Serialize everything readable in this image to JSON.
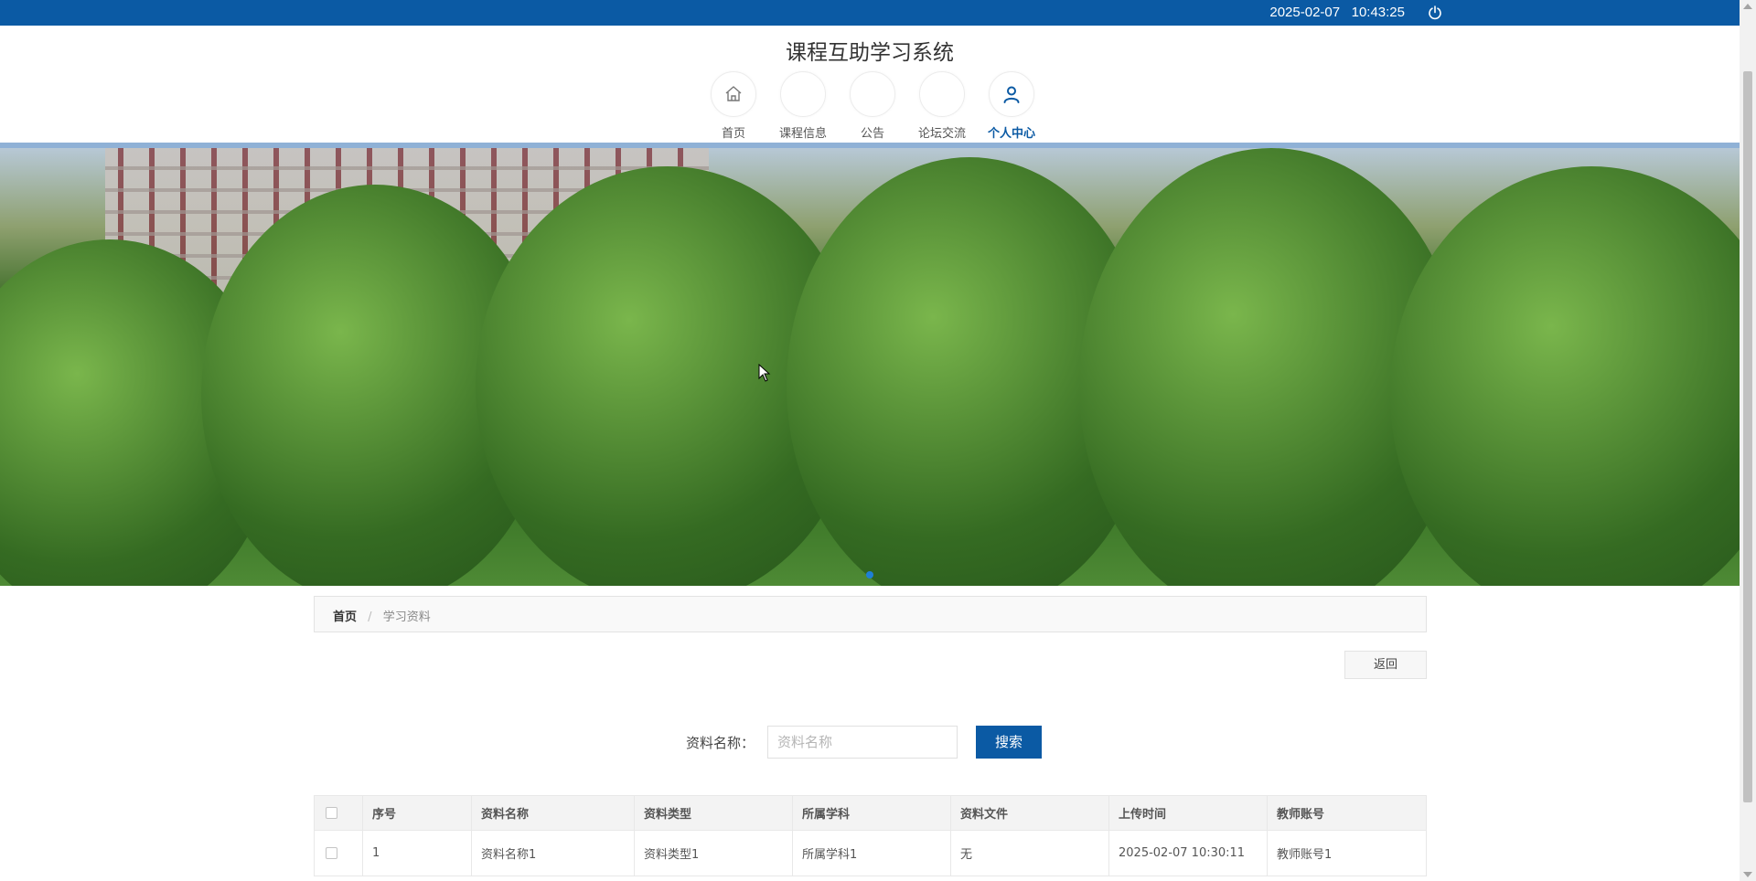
{
  "topbar": {
    "datetime": "2025-02-07   10:43:25",
    "power_icon": "power-icon",
    "color": "#0b5aa4"
  },
  "site": {
    "title": "课程互助学习系统"
  },
  "nav": {
    "items": [
      {
        "label": "首页",
        "icon": "home-icon",
        "active": false
      },
      {
        "label": "课程信息",
        "icon": "",
        "active": false
      },
      {
        "label": "公告",
        "icon": "",
        "active": false
      },
      {
        "label": "论坛交流",
        "icon": "",
        "active": false
      },
      {
        "label": "个人中心",
        "icon": "user-icon",
        "active": true
      }
    ]
  },
  "banner": {
    "slide_indicator": "carousel-dot"
  },
  "breadcrumb": {
    "home": "首页",
    "separator": "/",
    "current": "学习资料"
  },
  "actions": {
    "back_label": "返回"
  },
  "search": {
    "label": "资料名称：",
    "placeholder": "资料名称",
    "value": "",
    "button_label": "搜索"
  },
  "table": {
    "headers": [
      "序号",
      "资料名称",
      "资料类型",
      "所属学科",
      "资料文件",
      "上传时间",
      "教师账号"
    ],
    "rows": [
      [
        "1",
        "资料名称1",
        "资料类型1",
        "所属学科1",
        "无",
        "2025-02-07 10:30:11",
        "教师账号1"
      ]
    ]
  }
}
